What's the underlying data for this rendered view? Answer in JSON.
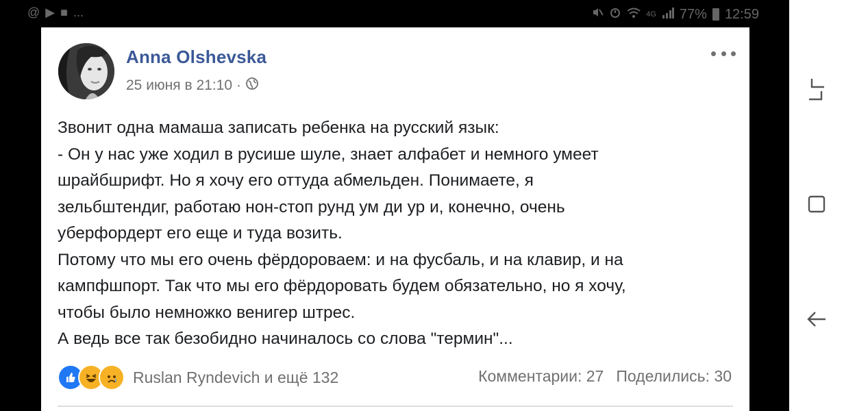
{
  "status_bar": {
    "left_icons": [
      "@",
      "▶",
      "■",
      "..."
    ],
    "battery": "77%",
    "time": "12:59",
    "network": "4G"
  },
  "post": {
    "author": "Anna Olshevska",
    "date": "25 июня в 21:10",
    "separator": "·",
    "privacy_icon": "globe-icon",
    "more_icon": "more-icon",
    "lines": [
      "Звонит одна мамаша записать ребенка на русский язык:",
      "- Он у нас уже ходил в русише шуле, знает алфабет и немного умеет",
      "шрайбшрифт. Но я хочу его оттуда абмельден. Понимаете, я",
      "зельбштендиг, работаю нон-стоп рунд ум ди ур и, конечно, очень",
      "уберфордерт его еще и туда возить.",
      "Потому что мы его очень фёрдороваем: и на фусбаль, и на клавир, и на",
      "кампфшпорт. Так что мы его фёрдоровать будем обязательно, но я хочу,",
      "чтобы было немножко венигер штрес.",
      "А ведь все так безобидно начиналось со слова \"термин\"..."
    ],
    "reactions": {
      "icons": [
        "like-icon",
        "haha-icon",
        "sad-icon"
      ],
      "text": "Ruslan Ryndevich и ещё 132"
    },
    "comments": "Комментарии: 27",
    "shares": "Поделились: 30"
  },
  "colors": {
    "author_link": "#3b5998",
    "meta_text": "#707070",
    "body_text": "#1c1e21",
    "like_blue": "#2078f4",
    "reaction_yellow": "#f7b125"
  }
}
